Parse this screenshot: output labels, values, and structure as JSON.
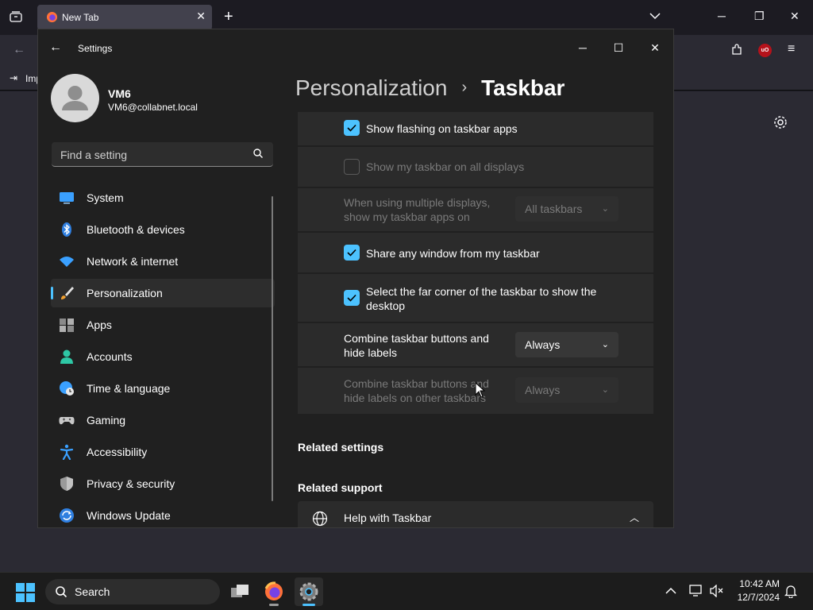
{
  "browser": {
    "tab_title": "New Tab",
    "bookmark_label": "Imp"
  },
  "settings": {
    "window_title": "Settings",
    "user": {
      "name": "VM6",
      "email": "VM6@collabnet.local"
    },
    "search_placeholder": "Find a setting",
    "nav": [
      {
        "label": "System",
        "icon": "monitor-icon"
      },
      {
        "label": "Bluetooth & devices",
        "icon": "bluetooth-icon"
      },
      {
        "label": "Network & internet",
        "icon": "wifi-icon"
      },
      {
        "label": "Personalization",
        "icon": "brush-icon",
        "active": true
      },
      {
        "label": "Apps",
        "icon": "apps-icon"
      },
      {
        "label": "Accounts",
        "icon": "person-icon"
      },
      {
        "label": "Time & language",
        "icon": "globe-clock-icon"
      },
      {
        "label": "Gaming",
        "icon": "gamepad-icon"
      },
      {
        "label": "Accessibility",
        "icon": "accessibility-icon"
      },
      {
        "label": "Privacy & security",
        "icon": "shield-icon"
      },
      {
        "label": "Windows Update",
        "icon": "update-icon"
      }
    ],
    "breadcrumb": {
      "parent": "Personalization",
      "current": "Taskbar"
    },
    "rows": {
      "flashing": {
        "label": "Show flashing on taskbar apps",
        "checked": true
      },
      "all_displays": {
        "label": "Show my taskbar on all displays",
        "checked": false,
        "disabled": true
      },
      "multi_display": {
        "label_line1": "When using multiple displays,",
        "label_line2": "show my taskbar apps on",
        "value": "All taskbars",
        "disabled": true
      },
      "share_window": {
        "label": "Share any window from my taskbar",
        "checked": true
      },
      "far_corner": {
        "label_line1": "Select the far corner of the taskbar to show the",
        "label_line2": "desktop",
        "checked": true
      },
      "combine": {
        "label_line1": "Combine taskbar buttons and",
        "label_line2": "hide labels",
        "value": "Always"
      },
      "combine_other": {
        "label_line1": "Combine taskbar buttons and",
        "label_line2": "hide labels on other taskbars",
        "value": "Always",
        "disabled": true
      }
    },
    "related_settings": "Related settings",
    "related_support": "Related support",
    "help_label": "Help with Taskbar"
  },
  "taskbar": {
    "search_label": "Search",
    "time": "10:42 AM",
    "date": "12/7/2024"
  },
  "colors": {
    "accent": "#4cc2ff",
    "window_bg": "#202020",
    "card_bg": "#2b2b2b"
  }
}
